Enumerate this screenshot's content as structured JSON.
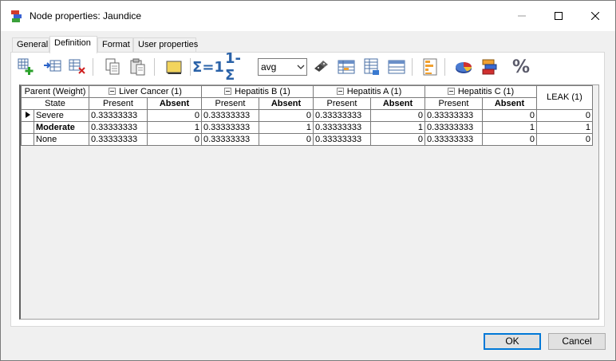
{
  "window": {
    "title": "Node properties: Jaundice",
    "controls": [
      "minimize-icon",
      "maximize-icon",
      "close-icon"
    ]
  },
  "tabs": [
    {
      "label": "General",
      "active": false
    },
    {
      "label": "Definition",
      "active": true
    },
    {
      "label": "Format",
      "active": false
    },
    {
      "label": "User properties",
      "active": false
    }
  ],
  "toolbar": {
    "icons": [
      "add-state-icon",
      "insert-state-icon",
      "delete-state-icon",
      "copy-icon",
      "paste-icon",
      "note-icon",
      "normalize-icon",
      "complement-icon"
    ],
    "normalize_label": "Σ=1",
    "complement_label": "1-Σ",
    "combo_value": "avg",
    "icons_right": [
      "randomize-icon",
      "table-icon",
      "noisy-adder-icon",
      "columns-icon",
      "bar-chart-icon",
      "pie-chart-icon",
      "stacked-bar-icon"
    ],
    "percent_label": "%"
  },
  "grid": {
    "header_row1": {
      "corner": "Parent (Weight)",
      "parents": [
        "Liver Cancer (1)",
        "Hepatitis B (1)",
        "Hepatitis A (1)",
        "Hepatitis C (1)"
      ],
      "leak": "LEAK (1)"
    },
    "header_row2": {
      "corner": "State",
      "present": "Present",
      "absent": "Absent"
    },
    "rows": [
      {
        "state": "Severe",
        "bold": false,
        "selected": true,
        "values": [
          "0.33333333",
          "0",
          "0.33333333",
          "0",
          "0.33333333",
          "0",
          "0.33333333",
          "0",
          "0"
        ]
      },
      {
        "state": "Moderate",
        "bold": true,
        "selected": false,
        "values": [
          "0.33333333",
          "1",
          "0.33333333",
          "1",
          "0.33333333",
          "1",
          "0.33333333",
          "1",
          "1"
        ]
      },
      {
        "state": "None",
        "bold": false,
        "selected": false,
        "values": [
          "0.33333333",
          "0",
          "0.33333333",
          "0",
          "0.33333333",
          "0",
          "0.33333333",
          "0",
          "0"
        ]
      }
    ]
  },
  "buttons": {
    "ok": "OK",
    "cancel": "Cancel"
  },
  "colors": {
    "accent": "#0078d7"
  }
}
